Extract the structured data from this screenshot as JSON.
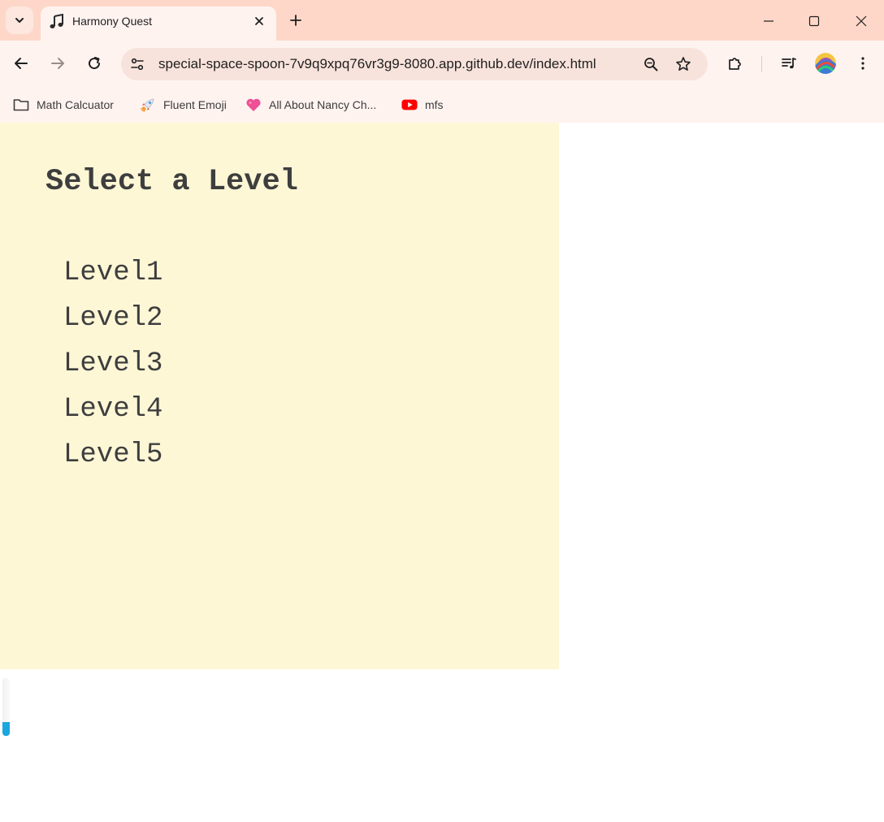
{
  "browser": {
    "tab": {
      "title": "Harmony Quest",
      "favicon": "music-note-icon"
    },
    "address_bar": {
      "url": "special-space-spoon-7v9q9xpq76vr3g9-8080.app.github.dev/index.html"
    },
    "bookmarks": [
      {
        "label": "Math Calcuator",
        "icon": "folder-icon"
      },
      {
        "label": "Fluent Emoji",
        "icon": "rocket-icon"
      },
      {
        "label": "All About Nancy Ch...",
        "icon": "heart-icon"
      },
      {
        "label": "mfs",
        "icon": "youtube-icon"
      }
    ],
    "colors": {
      "titlebar": "#fed7c8",
      "toolbar": "#fff3f0",
      "omnibox": "#f8e3dc"
    }
  },
  "page": {
    "heading": "Select a Level",
    "levels": [
      "Level1",
      "Level2",
      "Level3",
      "Level4",
      "Level5"
    ],
    "colors": {
      "panel_background": "#fdf7d6",
      "text": "#3e3e3e",
      "scroll_accent": "#1aa6e0"
    }
  }
}
